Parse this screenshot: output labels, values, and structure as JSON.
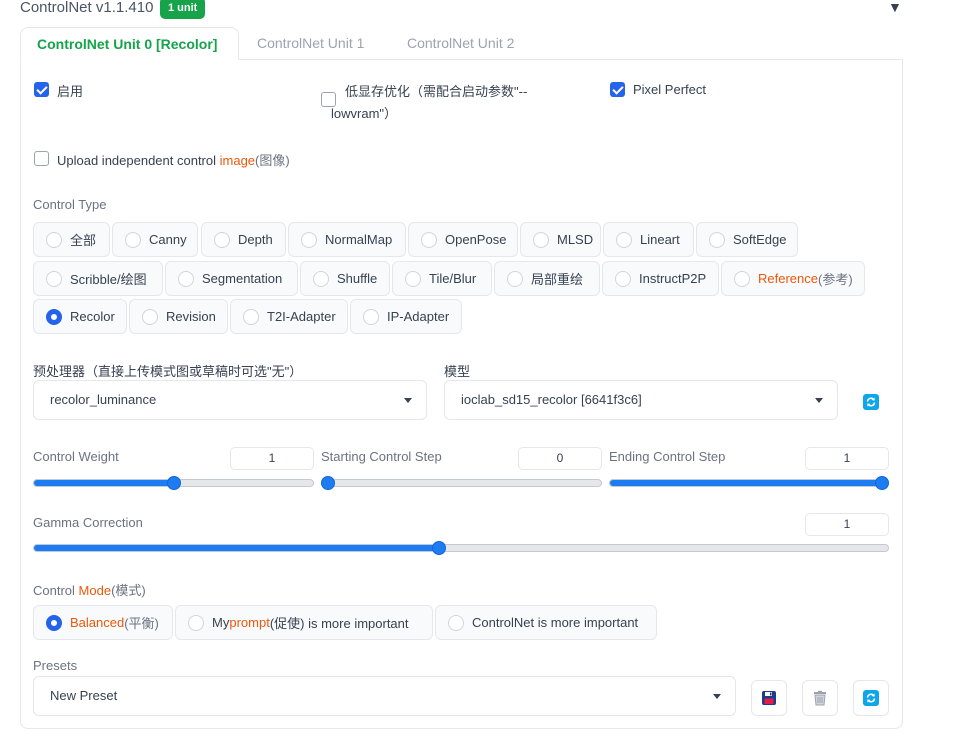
{
  "header": {
    "title": "ControlNet v1.1.410",
    "badge": "1 unit"
  },
  "tabs": [
    {
      "label": "ControlNet Unit 0 [Recolor]",
      "active": true
    },
    {
      "label": "ControlNet Unit 1",
      "active": false
    },
    {
      "label": "ControlNet Unit 2",
      "active": false
    }
  ],
  "options": {
    "enable": {
      "label": "启用",
      "checked": true
    },
    "lowvram": {
      "label_line1": "低显存优化（需配合启动参数\"--",
      "label_line2": "lowvram\"）",
      "checked": false
    },
    "pixel_perfect": {
      "label": "Pixel Perfect",
      "checked": true
    },
    "upload_independent": {
      "prefix": "Upload independent control ",
      "highlight": "image",
      "suffix": "(图像)",
      "checked": false
    }
  },
  "control_type": {
    "label": "Control Type",
    "options": [
      "全部",
      "Canny",
      "Depth",
      "NormalMap",
      "OpenPose",
      "MLSD",
      "Lineart",
      "SoftEdge",
      "Scribble/绘图",
      "Segmentation",
      "Shuffle",
      "Tile/Blur",
      "局部重绘",
      "InstructP2P",
      "Reference",
      "(参考)",
      "Recolor",
      "Revision",
      "T2I-Adapter",
      "IP-Adapter"
    ],
    "selected": "Recolor"
  },
  "preprocessor": {
    "label": "预处理器（直接上传模式图或草稿时可选\"无\"）",
    "value": "recolor_luminance"
  },
  "model": {
    "label": "模型",
    "value": "ioclab_sd15_recolor [6641f3c6]",
    "refresh_icon": "refresh-icon"
  },
  "sliders": {
    "control_weight": {
      "label": "Control Weight",
      "value": "1",
      "fraction": 0.5
    },
    "starting_step": {
      "label": "Starting Control Step",
      "value": "0",
      "fraction": 0.0
    },
    "ending_step": {
      "label": "Ending Control Step",
      "value": "1",
      "fraction": 1.0
    },
    "gamma": {
      "label": "Gamma Correction",
      "value": "1",
      "fraction": 0.474
    }
  },
  "control_mode": {
    "label_prefix": "Control ",
    "label_highlight": "Mode",
    "label_suffix": "(模式)",
    "balanced_main": "Balanced",
    "balanced_sub": "(平衡)",
    "prompt_prefix": "My ",
    "prompt_highlight": "prompt",
    "prompt_suffix": "(促使) is more important",
    "controlnet_option": "ControlNet is more important",
    "selected": "Balanced"
  },
  "presets": {
    "label": "Presets",
    "value": "New Preset",
    "save_icon": "save-icon",
    "delete_icon": "trash-icon",
    "refresh_icon": "refresh-icon"
  },
  "colors": {
    "accent_blue": "#2563eb",
    "brand_green": "#16a34a",
    "highlight_orange": "#ea580c",
    "slider_blue": "#1d7cf2"
  }
}
